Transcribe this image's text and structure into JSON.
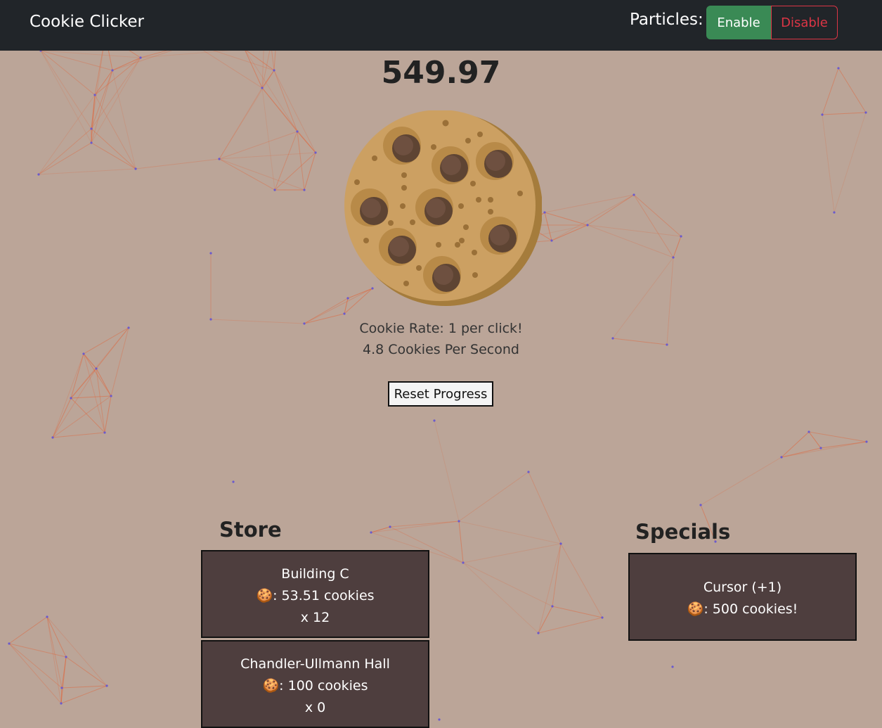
{
  "navbar": {
    "brand": "Cookie Clicker",
    "particles_label": "Particles:",
    "enable_label": "Enable",
    "disable_label": "Disable",
    "enable_color": "#3a8a55",
    "disable_color": "#dc3545"
  },
  "game": {
    "cookie_count": "549.97",
    "cookie_rate": "Cookie Rate: 1 per click!",
    "cookies_per_second": "4.8 Cookies Per Second",
    "reset_label": "Reset Progress"
  },
  "store": {
    "title": "Store",
    "items": [
      {
        "name": "Building C",
        "cost_icon": "🍪",
        "cost": ": 53.51 cookies",
        "owned": "x 12"
      },
      {
        "name": "Chandler-Ullmann Hall",
        "cost_icon": "🍪",
        "cost": ": 100 cookies",
        "owned": "x 0"
      }
    ]
  },
  "specials": {
    "title": "Specials",
    "items": [
      {
        "name": "Cursor (+1)",
        "cost_icon": "🍪",
        "cost": ": 500 cookies!"
      }
    ]
  },
  "colors": {
    "background": "#bba598",
    "navbar": "#212529",
    "card": "#4e3e3e",
    "particle_line": "#e0643a",
    "particle_dot": "#6a5acd"
  }
}
